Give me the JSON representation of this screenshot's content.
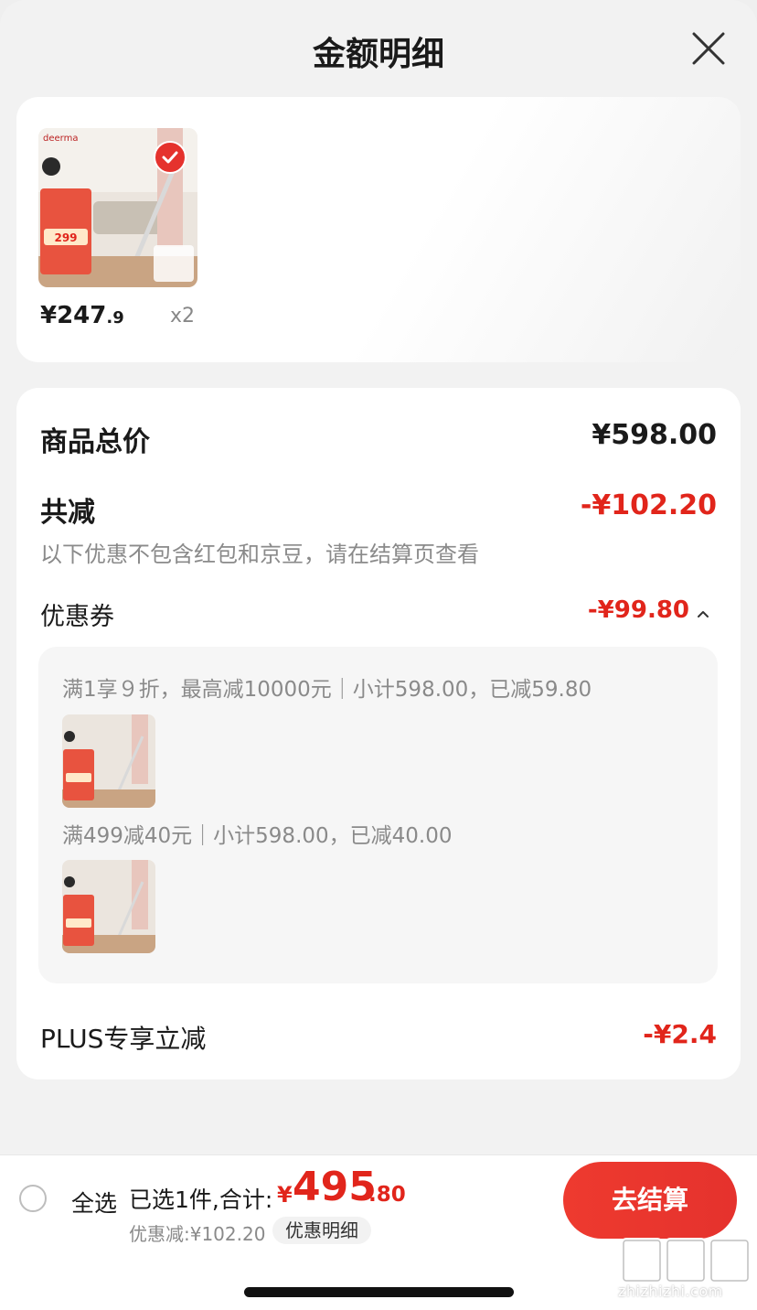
{
  "header": {
    "title": "金额明细"
  },
  "product": {
    "brand": "deerma",
    "promo_price_badge": "299",
    "price_int": "¥247",
    "price_dec": ".9",
    "qty": "x2"
  },
  "summary": {
    "total_label": "商品总价",
    "total_value": "¥598.00",
    "discount_label": "共减",
    "discount_value": "-¥102.20",
    "note": "以下优惠不包含红包和京豆，请在结算页查看",
    "coupon_label": "优惠券",
    "coupon_value": "-¥99.80",
    "coupon_rules": [
      "满1享９折，最高减10000元｜小计598.00，已减59.80",
      "满499减40元｜小计598.00，已减40.00"
    ],
    "plus_label": "PLUS专享立减",
    "plus_value": "-¥2.4"
  },
  "footer": {
    "select_all": "全选",
    "selected_text": "已选1件,合计:",
    "total_currency": "¥",
    "total_int": "495",
    "total_dec": ".80",
    "discount_text": "优惠减:¥102.20",
    "detail_button": "优惠明细",
    "checkout_button": "去结算"
  },
  "watermark": {
    "site": "zhizhizhi.com"
  },
  "colors": {
    "accent_red": "#e1251b",
    "checkout": "#e5322d"
  }
}
